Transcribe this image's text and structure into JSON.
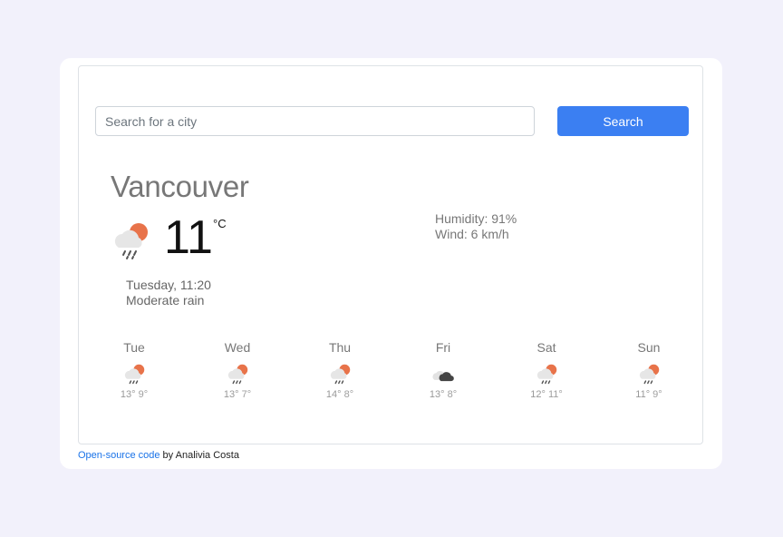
{
  "search": {
    "placeholder": "Search for a city",
    "button_label": "Search"
  },
  "current": {
    "city": "Vancouver",
    "temperature": "11",
    "unit": "°C",
    "icon": "rain-sun-icon",
    "humidity": "Humidity: 91%",
    "wind": "Wind: 6 km/h",
    "datetime": "Tuesday, 11:20",
    "description": "Moderate rain"
  },
  "forecast": [
    {
      "day": "Tue",
      "max": "13°",
      "min": "9°",
      "icon": "rain-sun-icon"
    },
    {
      "day": "Wed",
      "max": "13°",
      "min": "7°",
      "icon": "rain-sun-icon"
    },
    {
      "day": "Thu",
      "max": "14°",
      "min": "8°",
      "icon": "rain-sun-icon"
    },
    {
      "day": "Fri",
      "max": "13°",
      "min": "8°",
      "icon": "cloudy-icon"
    },
    {
      "day": "Sat",
      "max": "12°",
      "min": "11°",
      "icon": "rain-sun-icon"
    },
    {
      "day": "Sun",
      "max": "11°",
      "min": "9°",
      "icon": "rain-sun-icon"
    }
  ],
  "footer": {
    "link_text": "Open-source code",
    "credit_text": " by Analivia Costa"
  },
  "colors": {
    "accent": "#3b7ff2",
    "sun": "#e8734a",
    "page_background": "#f2f1fb"
  }
}
